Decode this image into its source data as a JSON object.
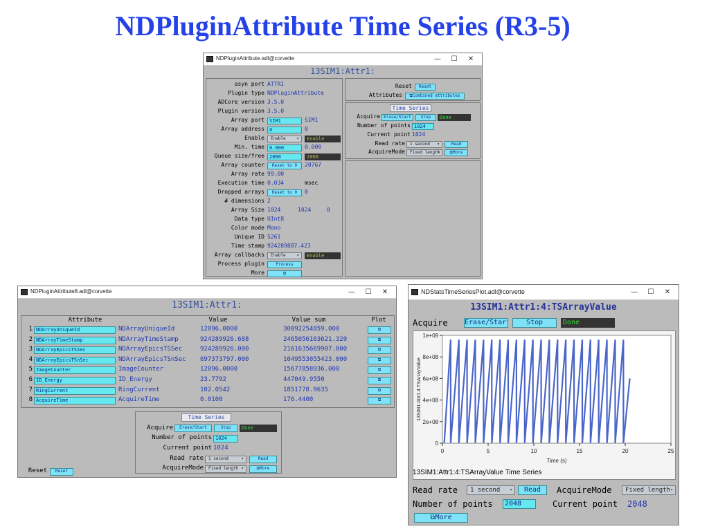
{
  "slide": {
    "title": "NDPluginAttribute Time Series (R3-5)"
  },
  "window_controls": {
    "min": "—",
    "max": "☐",
    "close": "✕"
  },
  "win1": {
    "title": "NDPluginAttribute.adl@corvette",
    "header": "13SIM1:Attr1:",
    "rows": [
      {
        "label": "asyn port",
        "value": "ATTR1"
      },
      {
        "label": "Plugin type",
        "value": "NDPluginAttribute"
      },
      {
        "label": "ADCore version",
        "value": "3.5.0"
      },
      {
        "label": "Plugin version",
        "value": "3.5.0"
      },
      {
        "label": "Array port",
        "input": "SIM1",
        "value": "SIM1"
      },
      {
        "label": "Array address",
        "input": "0",
        "value": "0"
      },
      {
        "label": "Enable",
        "menu": "Enable",
        "status": "Enable"
      },
      {
        "label": "Min. time",
        "input": "0.000",
        "value": "0.000"
      },
      {
        "label": "Queue size/free",
        "input": "2000",
        "status": "2000"
      },
      {
        "label": "Array counter",
        "button": "Reset to 0",
        "value": "20767"
      },
      {
        "label": "Array rate",
        "value": "99.00"
      },
      {
        "label": "Execution time",
        "value": "0.034",
        "unit": "msec"
      },
      {
        "label": "Dropped arrays",
        "button": "Reset to 0",
        "value": "0"
      },
      {
        "label": "# dimensions",
        "value": "2"
      },
      {
        "label": "Array Size",
        "value": "1024",
        "value2": "1024",
        "value3": "0"
      },
      {
        "label": "Data type",
        "value": "UInt8"
      },
      {
        "label": "Color mode",
        "value": "Mono"
      },
      {
        "label": "Unique ID",
        "value": "5261"
      },
      {
        "label": "Time stamp",
        "value": "924289887.423"
      },
      {
        "label": "Array callbacks",
        "menu": "Enable",
        "status": "Enable"
      },
      {
        "label": "Process plugin",
        "button": "Process"
      },
      {
        "label": "More",
        "button": "⧉"
      }
    ],
    "right": {
      "reset_label": "Reset",
      "reset_btn": "Reset",
      "attributes_label": "Attributes",
      "attributes_btn": "⧉Combined attributes",
      "ts_title": "Time Series",
      "acquire_label": "Acquire",
      "erase_btn": "Erase/Start",
      "stop_btn": "Stop",
      "status": "Done",
      "npoints_label": "Number of points",
      "npoints": "1024",
      "curpoint_label": "Current point",
      "curpoint": "1024",
      "readrate_label": "Read rate",
      "readrate_menu": "1 second",
      "read_btn": "Read",
      "acqmode_label": "AcquireMode",
      "acqmode_menu": "Fixed length",
      "more_btn": "⧉More"
    }
  },
  "win2": {
    "title": "NDPluginAttribute8.adl@corvette",
    "header": "13SIM1:Attr1:",
    "col_attribute": "Attribute",
    "col_value": "Value",
    "col_sum": "Value sum",
    "col_plot": "Plot",
    "rows": [
      {
        "n": "1",
        "input": "NDArrayUniqueId",
        "name": "NDArrayUniqueId",
        "value": "12096.0000",
        "sum": "30092254859.000",
        "plot": "⧉"
      },
      {
        "n": "2",
        "input": "NDArrayTimeStamp",
        "name": "NDArrayTimeStamp",
        "value": "924289926.688",
        "sum": "2465056163621.320",
        "plot": "⧉"
      },
      {
        "n": "3",
        "input": "NDArrayEpicsTSSec",
        "name": "NDArrayEpicsTSSec",
        "value": "924289926.000",
        "sum": "2161635669907.000",
        "plot": "⧉"
      },
      {
        "n": "4",
        "input": "NDArrayEpicsTSnSec",
        "name": "NDArrayEpicsTSnSec",
        "value": "697373797.000",
        "sum": "1049553055423.000",
        "plot": "⧉"
      },
      {
        "n": "5",
        "input": "ImageCounter",
        "name": "ImageCounter",
        "value": "12096.0000",
        "sum": "15677858936.000",
        "plot": "⧉"
      },
      {
        "n": "6",
        "input": "ID_Energy",
        "name": "ID_Energy",
        "value": "23.7792",
        "sum": "447049.9550",
        "plot": "⧉"
      },
      {
        "n": "7",
        "input": "RingCurrent",
        "name": "RingCurrent",
        "value": "102.0542",
        "sum": "1851778.9635",
        "plot": "⧉"
      },
      {
        "n": "8",
        "input": "AcquireTime",
        "name": "AcquireTime",
        "value": "0.0100",
        "sum": "176.4400",
        "plot": "⧉"
      }
    ],
    "ts_title": "Time Series",
    "acquire_label": "Acquire",
    "erase_btn": "Erase/Start",
    "stop_btn": "Stop",
    "status": "Done",
    "npoints_label": "Number of points",
    "npoints": "1024",
    "curpoint_label": "Current point",
    "curpoint": "1024",
    "readrate_label": "Read rate",
    "readrate_menu": "1 second",
    "read_btn": "Read",
    "acqmode_label": "AcquireMode",
    "acqmode_menu": "Fixed length",
    "more_btn": "⧉More",
    "reset_label": "Reset",
    "reset_btn": "Reset"
  },
  "win3": {
    "title": "NDStatsTimeSeriesPlot.adl@corvette",
    "header": "13SIM1:Attr1:4:TSArrayValue",
    "acquire_label": "Acquire",
    "erase_btn": "Erase/Start",
    "stop_btn": "Stop",
    "status": "Done",
    "plot_caption": "13SIM1:Attr1:4:TSArrayValue Time Series",
    "readrate_label": "Read rate",
    "readrate_menu": "1 second",
    "read_btn": "Read",
    "acqmode_label": "AcquireMode",
    "acqmode_menu": "Fixed length",
    "npoints_label": "Number of points",
    "npoints": "2048",
    "curpoint_label": "Current point",
    "curpoint": "2048",
    "more_btn": "⧉More"
  },
  "chart_data": {
    "type": "line",
    "title": "",
    "xlabel": "Time (s)",
    "ylabel": "13SIM1:Attr1:4:TSArrayValue",
    "xlim": [
      0,
      25
    ],
    "ylim": [
      0,
      1000000000
    ],
    "xticks": [
      "0",
      "5",
      "10",
      "15",
      "20",
      "25"
    ],
    "yticks": [
      "0",
      "2e+08",
      "4e+08",
      "6e+08",
      "8e+08",
      "1e+09"
    ],
    "color": "#4a66c8",
    "series": [
      {
        "x": [
          0.2,
          0.9,
          0.9,
          1.8,
          1.8,
          2.7,
          2.7,
          3.6,
          3.6,
          4.5,
          4.5,
          5.4,
          5.4,
          6.3,
          6.3,
          7.2,
          7.2,
          8.1,
          8.1,
          9.0,
          9.0,
          9.9,
          9.9,
          10.8,
          10.8,
          11.7,
          11.7,
          12.6,
          12.6,
          13.5,
          13.5,
          14.4,
          14.4,
          15.3,
          15.3,
          16.2,
          16.2,
          17.1,
          17.1,
          18.0,
          18.0,
          18.9,
          18.9,
          19.8,
          19.8,
          20.5
        ],
        "y": [
          0,
          960000000,
          0,
          960000000,
          0,
          960000000,
          0,
          960000000,
          0,
          960000000,
          0,
          960000000,
          0,
          960000000,
          0,
          960000000,
          0,
          960000000,
          0,
          960000000,
          0,
          960000000,
          0,
          960000000,
          0,
          960000000,
          0,
          960000000,
          0,
          960000000,
          0,
          960000000,
          0,
          960000000,
          0,
          960000000,
          0,
          960000000,
          0,
          960000000,
          0,
          960000000,
          0,
          960000000,
          0,
          600000000
        ]
      }
    ]
  }
}
